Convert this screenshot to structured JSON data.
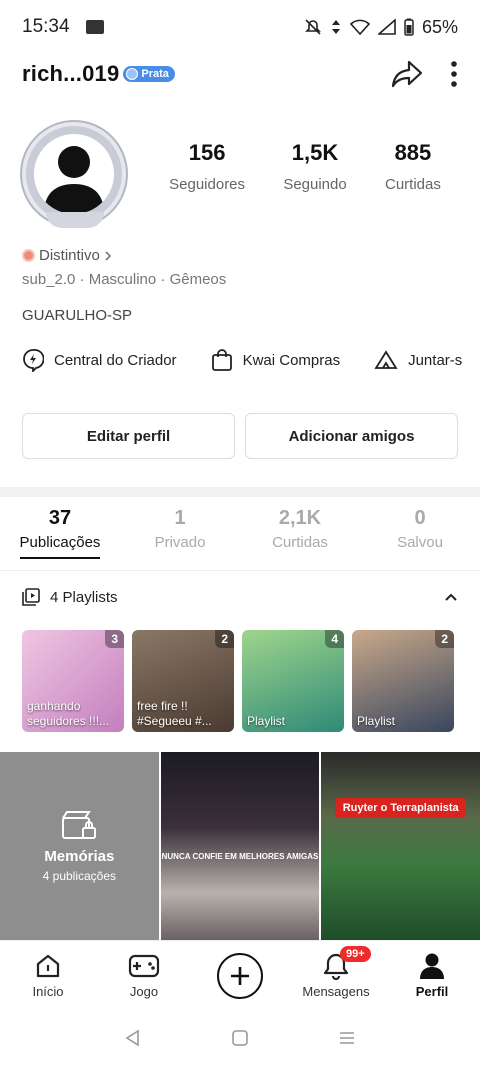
{
  "status": {
    "time": "15:34",
    "battery": "65%"
  },
  "profile": {
    "username": "rich...019",
    "badge": "Prata",
    "stats": [
      {
        "value": "156",
        "label": "Seguidores"
      },
      {
        "value": "1,5K",
        "label": "Seguindo"
      },
      {
        "value": "885",
        "label": "Curtidas"
      }
    ],
    "distintivo": "Distintivo",
    "meta": "sub_2.0 · Masculino · Gêmeos",
    "location": "GUARULHO-SP"
  },
  "shortcuts": [
    {
      "label": "Central do Criador",
      "icon": "creator-bolt-icon"
    },
    {
      "label": "Kwai Compras",
      "icon": "shopping-bag-icon"
    },
    {
      "label": "Juntar-s",
      "icon": "tent-icon"
    }
  ],
  "buttons": {
    "edit": "Editar perfil",
    "add_friends": "Adicionar amigos"
  },
  "tabs": [
    {
      "count": "37",
      "label": "Publicações"
    },
    {
      "count": "1",
      "label": "Privado"
    },
    {
      "count": "2,1K",
      "label": "Curtidas"
    },
    {
      "count": "0",
      "label": "Salvou"
    }
  ],
  "playlists": {
    "header": "4 Playlists",
    "items": [
      {
        "count": "3",
        "title": "ganhando seguidores !!!...",
        "colors": [
          "#e9b3d8",
          "#c97bc0"
        ]
      },
      {
        "count": "2",
        "title": "free fire !! #Segueeu #...",
        "colors": [
          "#6b5a4a",
          "#a3826a"
        ]
      },
      {
        "count": "4",
        "title": "Playlist",
        "colors": [
          "#7cc36a",
          "#3d8a4a"
        ]
      },
      {
        "count": "2",
        "title": "Playlist",
        "colors": [
          "#6a8bbf",
          "#3b4a66"
        ]
      }
    ]
  },
  "grid": {
    "memorias_title": "Memórias",
    "memorias_sub": "4 publicações",
    "video2_caption": "NUNCA CONFIE EM MELHORES AMIGAS",
    "video3_title": "Ruyter o Terraplanista"
  },
  "nav": {
    "items": [
      {
        "label": "Início",
        "icon": "home-icon"
      },
      {
        "label": "Jogo",
        "icon": "gamepad-icon"
      },
      {
        "label": "",
        "icon": "plus-circle-icon"
      },
      {
        "label": "Mensagens",
        "icon": "bell-icon",
        "badge": "99+"
      },
      {
        "label": "Perfil",
        "icon": "profile-icon"
      }
    ]
  }
}
